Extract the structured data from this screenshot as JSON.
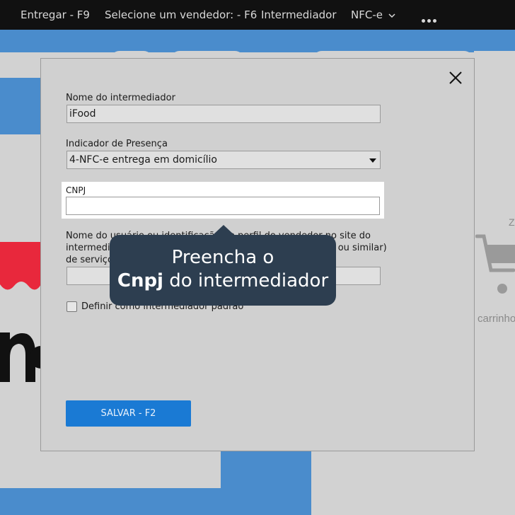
{
  "navbar": {
    "items": [
      {
        "label": "Entregar - F9"
      },
      {
        "label": "Selecione um vendedor: - F6"
      },
      {
        "label": "Intermediador"
      },
      {
        "label": "NFC-e"
      }
    ]
  },
  "background": {
    "cart_label": "carrinho",
    "cart_top_letter": "Z"
  },
  "modal": {
    "intermediary_name_label": "Nome do intermediador",
    "intermediary_name_value": "iFood",
    "presence_label": "Indicador de Presença",
    "presence_value": "4-NFC-e entrega em domicílio",
    "cnpj_label": "CNPJ",
    "cnpj_value": "",
    "user_id_label_1": "Nome do usuário ou identificação do perfil do vendedor no site do",
    "user_id_label_2": "intermediador (ou site do comprador, empresa de entrega ou similar)",
    "user_id_label_3": "de serviços",
    "user_id_value": "",
    "default_checkbox_label": "Definir como intermediador padrão",
    "save_label": "SALVAR - F2"
  },
  "tooltip": {
    "line1": "Preencha o",
    "line2_bold": "Cnpj",
    "line2_rest": " do intermediador"
  },
  "colors": {
    "navbar_bg": "#111111",
    "accent_blue": "#4a8ccc",
    "save_button": "#1a7ad4",
    "tooltip_bg": "#2d3e50",
    "logo_red": "#e8283c"
  }
}
